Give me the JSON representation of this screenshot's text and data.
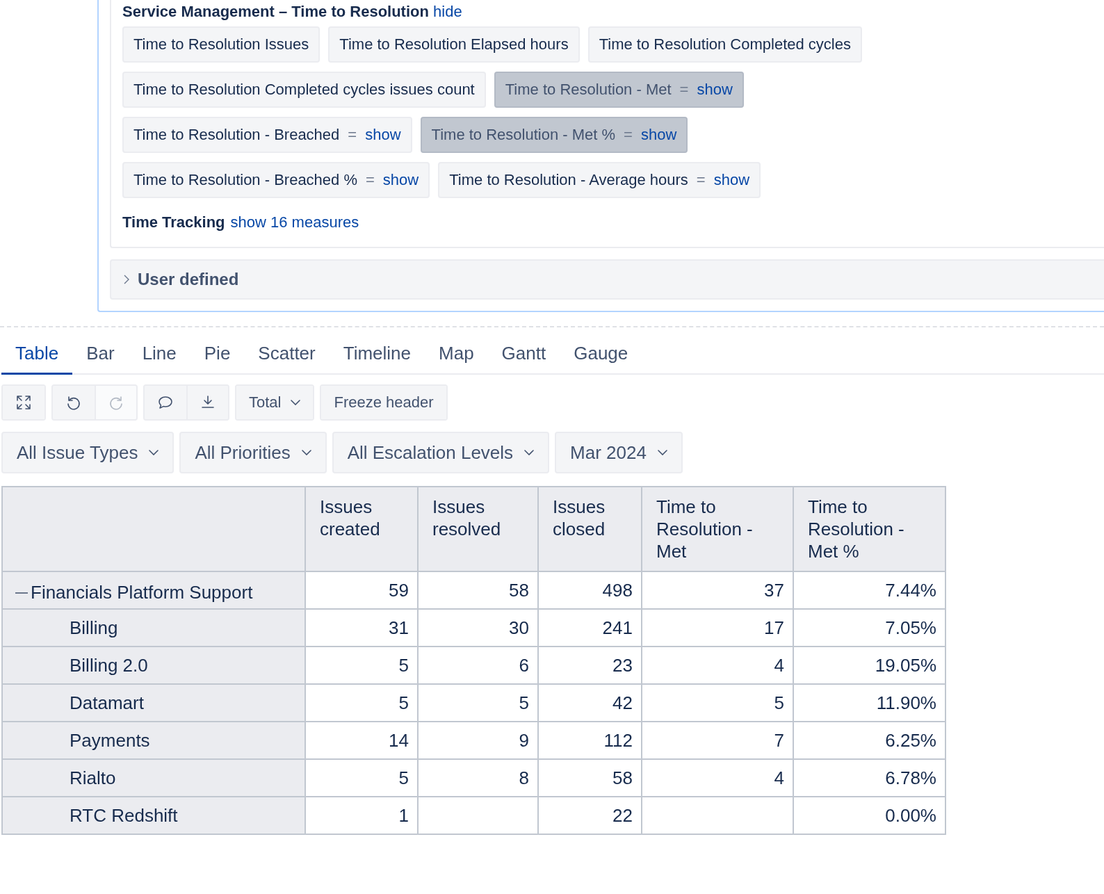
{
  "measures_panel": {
    "section_title": "Service Management – Time to Resolution",
    "section_link": "hide",
    "chips": [
      {
        "label": "Time to Resolution Issues",
        "selected": false
      },
      {
        "label": "Time to Resolution Elapsed hours",
        "selected": false
      },
      {
        "label": "Time to Resolution Completed cycles",
        "selected": false
      },
      {
        "label": "Time to Resolution Completed cycles issues count",
        "selected": false
      },
      {
        "label": "Time to Resolution - Met",
        "selected": true,
        "equals": "=",
        "action": "show"
      },
      {
        "label": "Time to Resolution - Breached",
        "selected": false,
        "equals": "=",
        "action": "show"
      },
      {
        "label": "Time to Resolution - Met %",
        "selected": true,
        "equals": "=",
        "action": "show"
      },
      {
        "label": "Time to Resolution - Breached %",
        "selected": false,
        "equals": "=",
        "action": "show"
      },
      {
        "label": "Time to Resolution - Average hours",
        "selected": false,
        "equals": "=",
        "action": "show"
      }
    ],
    "other_section": {
      "title": "Time Tracking",
      "link": "show 16 measures"
    },
    "user_defined": {
      "title": "User defined",
      "expanded": false
    }
  },
  "tabs": [
    {
      "label": "Table",
      "selected": true
    },
    {
      "label": "Bar",
      "selected": false
    },
    {
      "label": "Line",
      "selected": false
    },
    {
      "label": "Pie",
      "selected": false
    },
    {
      "label": "Scatter",
      "selected": false
    },
    {
      "label": "Timeline",
      "selected": false
    },
    {
      "label": "Map",
      "selected": false
    },
    {
      "label": "Gantt",
      "selected": false
    },
    {
      "label": "Gauge",
      "selected": false
    }
  ],
  "toolbar": [
    [
      {
        "kind": "fullscreen",
        "disabled": false
      }
    ],
    [
      {
        "kind": "undo",
        "disabled": false
      },
      {
        "kind": "redo",
        "disabled": true
      }
    ],
    [
      {
        "kind": "comment",
        "disabled": false
      },
      {
        "kind": "download",
        "disabled": false
      }
    ],
    [
      {
        "kind": "dropdown",
        "label": "Total",
        "disabled": false
      }
    ],
    [
      {
        "kind": "button",
        "label": "Freeze header",
        "disabled": false
      }
    ]
  ],
  "filters": [
    "All Issue Types",
    "All Priorities",
    "All Escalation Levels",
    "Mar 2024"
  ],
  "table": {
    "columns": [
      "Issues created",
      "Issues resolved",
      "Issues closed",
      "Time to Resolution - Met",
      "Time to Resolution - Met %"
    ],
    "rows": [
      {
        "label": "Financials Platform Support",
        "expanded": true,
        "cells": [
          "59",
          "58",
          "498",
          "37",
          "7.44%"
        ],
        "children": [
          {
            "label": "Billing",
            "cells": [
              "31",
              "30",
              "241",
              "17",
              "7.05%"
            ]
          },
          {
            "label": "Billing 2.0",
            "cells": [
              "5",
              "6",
              "23",
              "4",
              "19.05%"
            ]
          },
          {
            "label": "Datamart",
            "cells": [
              "5",
              "5",
              "42",
              "5",
              "11.90%"
            ]
          },
          {
            "label": "Payments",
            "cells": [
              "14",
              "9",
              "112",
              "7",
              "6.25%"
            ]
          },
          {
            "label": "Rialto",
            "cells": [
              "5",
              "8",
              "58",
              "4",
              "6.78%"
            ]
          },
          {
            "label": "RTC Redshift",
            "cells": [
              "1",
              "",
              "22",
              "",
              "0.00%"
            ]
          }
        ]
      }
    ]
  }
}
